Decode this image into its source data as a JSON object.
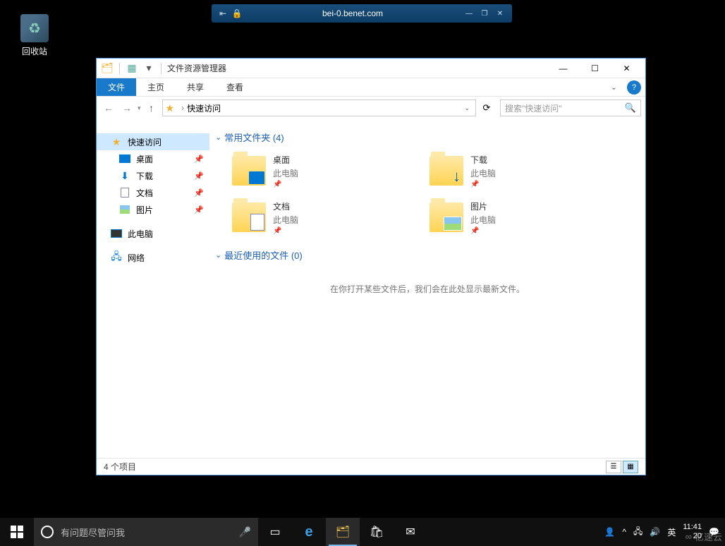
{
  "vm_titlebar": {
    "host": "bei-0.benet.com"
  },
  "desktop": {
    "recycle_bin": "回收站"
  },
  "explorer": {
    "title": "文件资源管理器",
    "tabs": {
      "file": "文件",
      "home": "主页",
      "share": "共享",
      "view": "查看"
    },
    "breadcrumb": {
      "root": "快速访问"
    },
    "search_placeholder": "搜索\"快速访问\"",
    "nav": {
      "quick_access": "快速访问",
      "desktop": "桌面",
      "downloads": "下载",
      "documents": "文档",
      "pictures": "图片",
      "this_pc": "此电脑",
      "network": "网络"
    },
    "sections": {
      "frequent": "常用文件夹 (4)",
      "recent": "最近使用的文件 (0)"
    },
    "folders": [
      {
        "name": "桌面",
        "loc": "此电脑",
        "icon": "desktop"
      },
      {
        "name": "下载",
        "loc": "此电脑",
        "icon": "downloads"
      },
      {
        "name": "文档",
        "loc": "此电脑",
        "icon": "documents"
      },
      {
        "name": "图片",
        "loc": "此电脑",
        "icon": "pictures"
      }
    ],
    "empty_recent": "在你打开某些文件后，我们会在此处显示最新文件。",
    "status": "4 个项目"
  },
  "taskbar": {
    "search_placeholder": "有问题尽管问我",
    "ime": "英",
    "time": "11:41",
    "date": "20"
  },
  "watermark": "亿速云"
}
